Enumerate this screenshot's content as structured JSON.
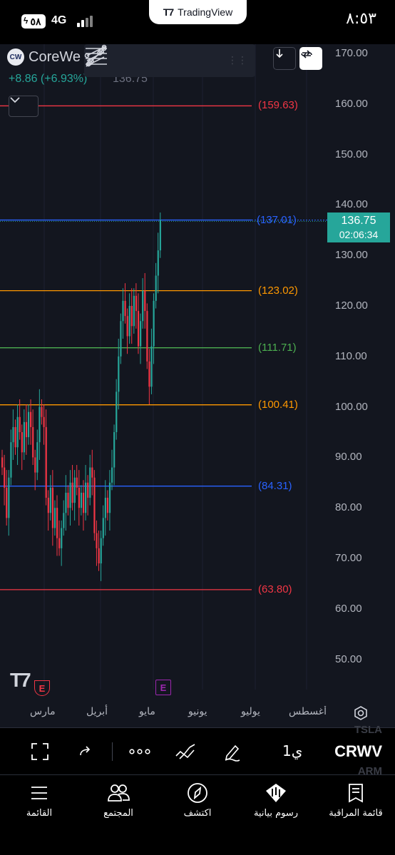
{
  "status_bar": {
    "battery": "٥٨",
    "network": "4G",
    "app_name": "TradingView",
    "time": "٨:٥٣"
  },
  "symbol": {
    "logo": "CW",
    "name": "CoreWe",
    "change": "+8.86 (+6.93%)",
    "price": "136.75"
  },
  "drawing_tools": [
    "parallel-channel-icon",
    "fib-retracement-icon",
    "trend-line-icon",
    "ray-line-icon"
  ],
  "price_axis": {
    "labels": [
      "170.00",
      "160.00",
      "150.00",
      "140.00",
      "130.00",
      "120.00",
      "110.00",
      "100.00",
      "90.00",
      "80.00",
      "70.00",
      "60.00",
      "50.00"
    ]
  },
  "last_price": {
    "price": "136.75",
    "countdown": "02:06:34"
  },
  "levels": [
    {
      "value": 159.63,
      "label": "(159.63)",
      "color": "#f23645"
    },
    {
      "value": 137.01,
      "label": "(137.01)",
      "color": "#2962ff"
    },
    {
      "value": 123.02,
      "label": "(123.02)",
      "color": "#ff9800"
    },
    {
      "value": 111.71,
      "label": "(111.71)",
      "color": "#4caf50"
    },
    {
      "value": 100.41,
      "label": "(100.41)",
      "color": "#ff9800"
    },
    {
      "value": 84.31,
      "label": "(84.31)",
      "color": "#2962ff"
    },
    {
      "value": 63.8,
      "label": "(63.80)",
      "color": "#f23645"
    }
  ],
  "time_axis": {
    "months": [
      "مارس",
      "أبريل",
      "مايو",
      "يونيو",
      "يوليو",
      "أغسطس"
    ]
  },
  "earnings_marker": "E",
  "bottom_toolbar": {
    "symbol": "CRWV",
    "symbol_above": "TSLA",
    "symbol_below": "ARM",
    "interval": "1ي"
  },
  "bottom_nav": [
    {
      "label": "قائمة المراقبة",
      "icon": "watchlist-icon"
    },
    {
      "label": "رسوم بيانية",
      "icon": "chart-icon"
    },
    {
      "label": "اكتشف",
      "icon": "compass-icon"
    },
    {
      "label": "المجتمع",
      "icon": "community-icon"
    },
    {
      "label": "القائمة",
      "icon": "menu-icon"
    }
  ],
  "colors": {
    "up": "#26a69a",
    "down": "#f23645",
    "background": "#13161f"
  }
}
